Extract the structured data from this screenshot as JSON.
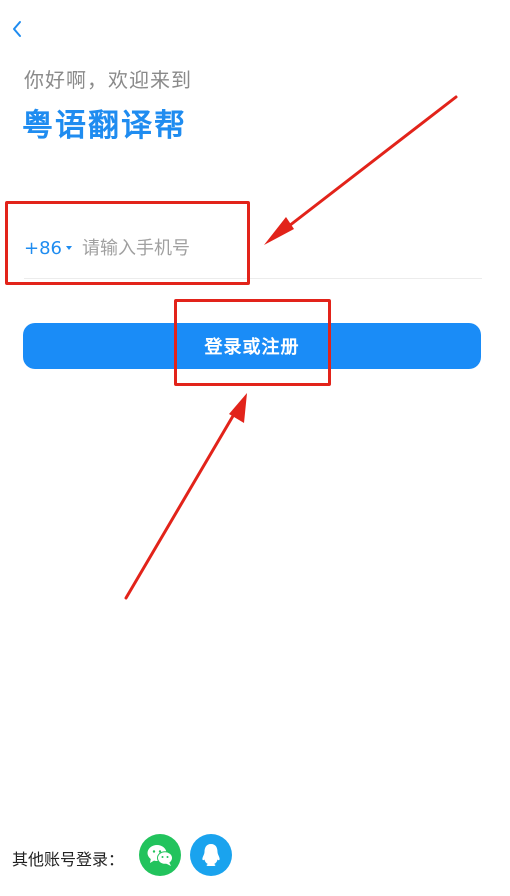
{
  "header": {
    "back_icon": "chevron-left-icon",
    "greeting": "你好啊，欢迎来到",
    "app_name": "粤语翻译帮"
  },
  "phone": {
    "country_code": "+86",
    "caret_icon": "caret-down-icon",
    "placeholder": "请输入手机号",
    "value": ""
  },
  "login_button": {
    "label": "登录或注册"
  },
  "other_login": {
    "label": "其他账号登录：",
    "providers": [
      {
        "name": "wechat",
        "icon": "wechat-icon",
        "color": "#22c35d"
      },
      {
        "name": "qq",
        "icon": "qq-icon",
        "color": "#1aa3ee"
      }
    ]
  },
  "colors": {
    "accent": "#1f8cf0",
    "button": "#1a8cf7",
    "annotation": "#e2231a"
  }
}
